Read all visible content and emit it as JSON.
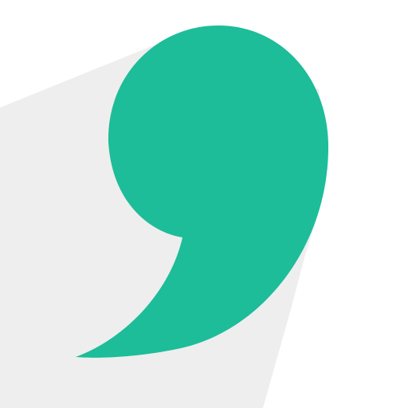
{
  "icon": {
    "name": "comma-icon",
    "colors": {
      "background": "#ffffff",
      "shadow": "#eeeeee",
      "glyph": "#1dbd99"
    }
  }
}
